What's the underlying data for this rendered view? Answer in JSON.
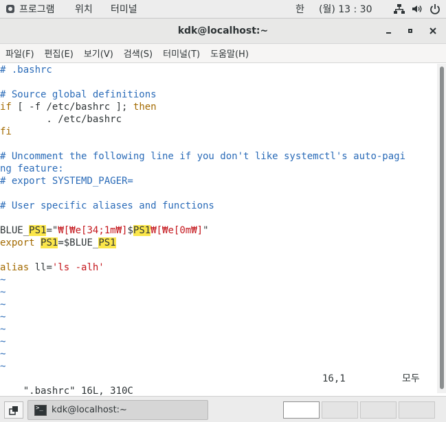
{
  "topbar": {
    "applications": "프로그램",
    "places": "위치",
    "terminal": "터미널",
    "ime": "한",
    "clock": "(월) 13 : 30"
  },
  "window": {
    "title": "kdk@localhost:~"
  },
  "menubar": [
    "파일(F)",
    "편집(E)",
    "보기(V)",
    "검색(S)",
    "터미널(T)",
    "도움말(H)"
  ],
  "editor": {
    "file_comment": "# .bashrc",
    "source_comment": "# Source global definitions",
    "if_kw": "if",
    "if_test": "[ -f /etc/bashrc ];",
    "then_kw": "then",
    "source_line": "        . /etc/bashrc",
    "fi_kw": "fi",
    "uncomment_1": "# Uncomment the following line if you don't like systemctl's auto-pagi",
    "uncomment_2": "ng feature:",
    "export_pager": "# export SYSTEMD_PAGER=",
    "user_comment": "# User specific aliases and functions",
    "blue_a": "BLUE_",
    "blue_b": "PS1",
    "blue_c": "=\"",
    "blue_d": "₩[₩e[34;1m₩]",
    "blue_e": "$",
    "blue_f": "PS1",
    "blue_g": "₩[₩e[0m₩]",
    "blue_h": "\"",
    "export_kw": "export",
    "export_a": "PS1",
    "export_b": "=$BLUE_",
    "export_c": "PS1",
    "alias_kw": "alias",
    "alias_a": " ll=",
    "alias_b": "'ls -alh'",
    "tilde": "~",
    "status_file": "\".bashrc\" 16L, 310C",
    "status_pos": "16,1",
    "status_mode": "모두"
  },
  "taskbar": {
    "item_label": "kdk@localhost:~"
  },
  "colors": {
    "comment": "#2a6bb8",
    "keyword": "#a36a00",
    "string": "#c4161c",
    "search_highlight": "#fbe64a"
  }
}
